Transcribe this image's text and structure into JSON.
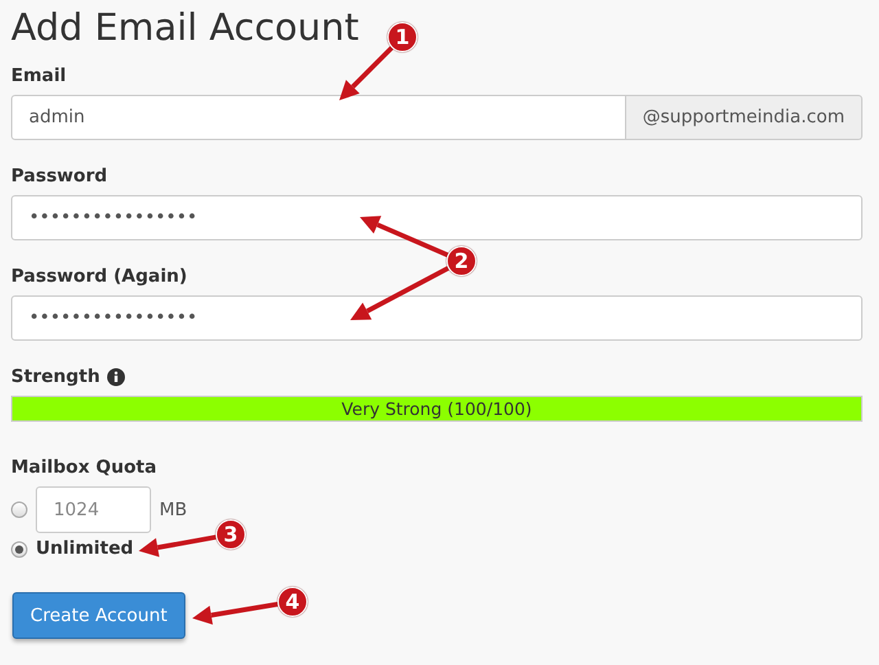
{
  "title": "Add Email Account",
  "email": {
    "label": "Email",
    "value": "admin",
    "domain": "@supportmeindia.com"
  },
  "password": {
    "label": "Password",
    "value": "••••••••••••••••"
  },
  "password_again": {
    "label": "Password (Again)",
    "value": "••••••••••••••••"
  },
  "strength": {
    "label": "Strength",
    "level": 1,
    "reading": "Very Strong (100/100)"
  },
  "quota": {
    "label": "Mailbox Quota",
    "options": [
      {
        "kind": "amount",
        "selected": false,
        "placeholder": "1024",
        "unit": "MB"
      },
      {
        "kind": "text",
        "selected": true,
        "label": "Unlimited"
      }
    ]
  },
  "submit": "Create Account",
  "callouts": [
    {
      "number": "1"
    },
    {
      "number": "2"
    },
    {
      "number": "3"
    },
    {
      "number": "4"
    }
  ]
}
